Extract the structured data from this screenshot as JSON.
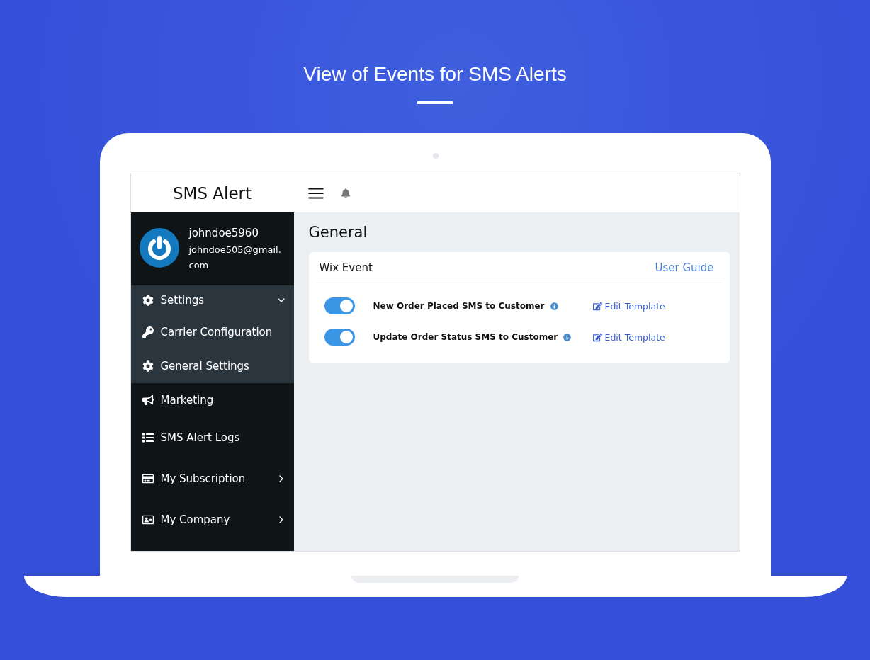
{
  "headline": "View of Events for SMS Alerts",
  "app": {
    "brand": "SMS Alert",
    "user": {
      "name": "johndoe5960",
      "email": "johndoe505@gmail.\ncom"
    },
    "sidebar": {
      "items": [
        {
          "label": "Settings",
          "expanded": true,
          "children": [
            {
              "label": "Carrier Configuration"
            },
            {
              "label": "General Settings"
            }
          ]
        },
        {
          "label": "Marketing"
        },
        {
          "label": "SMS Alert Logs"
        },
        {
          "label": "My Subscription",
          "expanded": false
        },
        {
          "label": "My Company",
          "expanded": false
        }
      ]
    },
    "page_title": "General",
    "card": {
      "title": "Wix Event",
      "link": "User Guide",
      "events": [
        {
          "label": "New Order Placed SMS to Customer",
          "on": true,
          "action": "Edit Template"
        },
        {
          "label": "Update Order Status SMS to Customer",
          "on": true,
          "action": "Edit Template"
        }
      ]
    }
  }
}
